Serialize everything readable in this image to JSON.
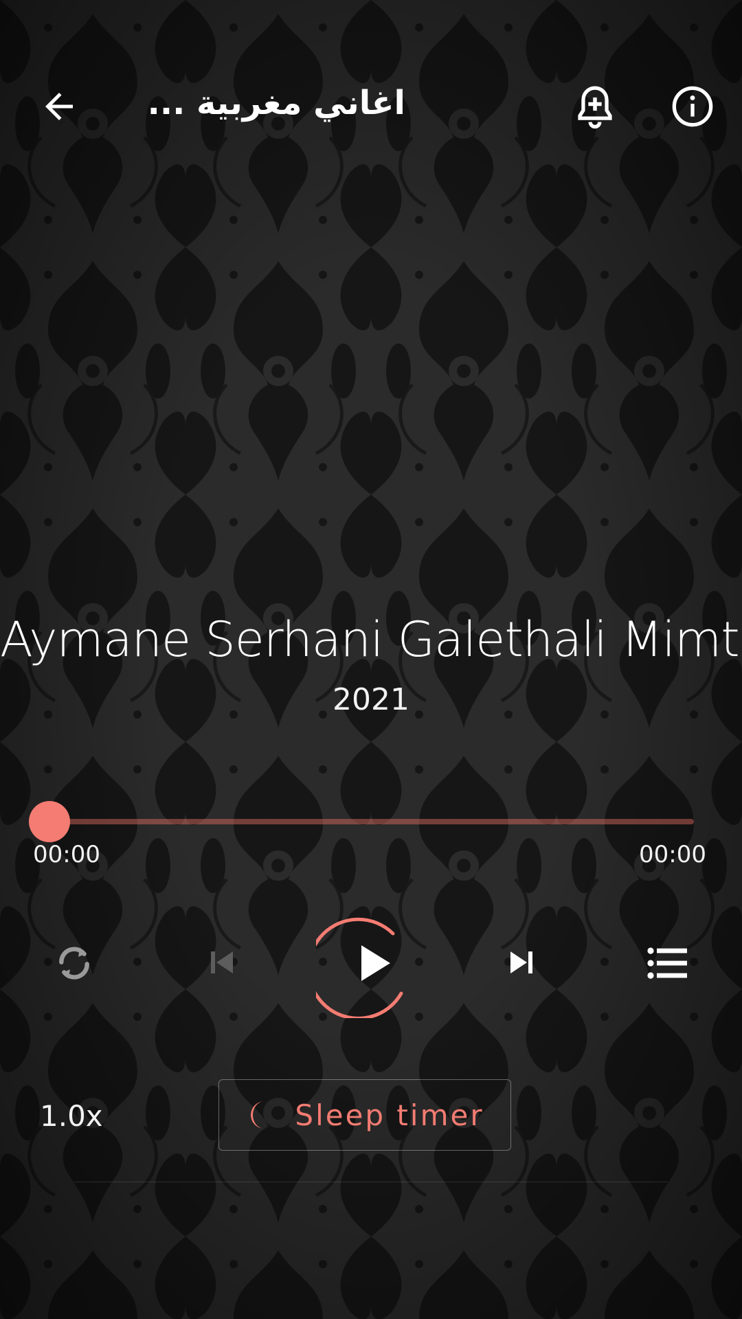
{
  "header": {
    "title": "اغاني مغربية ...",
    "back_icon": "arrow-back-icon",
    "reminder_icon": "bell-plus-icon",
    "info_icon": "info-icon"
  },
  "song": {
    "title": "Aymane Serhani Galethali Mimti",
    "year": "2021"
  },
  "progress": {
    "elapsed": "00:00",
    "duration": "00:00",
    "fraction": 0.0
  },
  "controls": {
    "repeat_icon": "repeat-icon",
    "previous_icon": "skip-previous-icon",
    "play_icon": "play-icon",
    "next_icon": "skip-next-icon",
    "queue_icon": "queue-list-icon",
    "previous_enabled": false
  },
  "playback": {
    "speed": "1.0x",
    "sleep_timer_label": "Sleep timer",
    "sleep_icon": "moon-icon"
  },
  "colors": {
    "accent": "#f47c72",
    "background": "#222222",
    "text": "#ffffff"
  }
}
